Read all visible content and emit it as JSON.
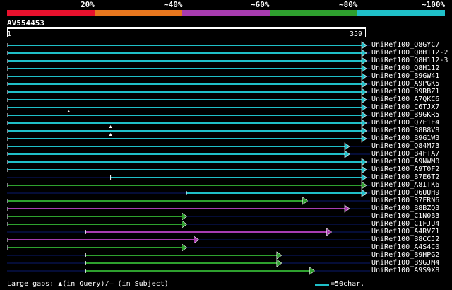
{
  "legend": {
    "labels": [
      "20%",
      "~40%",
      "~60%",
      "~80%",
      "~100%"
    ],
    "colors": [
      "#e8112d",
      "#e8771e",
      "#a83cb0",
      "#2ea02e",
      "#1fbfc8"
    ]
  },
  "query": {
    "name": "AV554453",
    "start": "1",
    "end": "359"
  },
  "hits": [
    {
      "label": "UniRef100_Q8GYC7",
      "color": "cyan",
      "start": 1,
      "end": 359,
      "gap": null
    },
    {
      "label": "UniRef100_Q8H112-2",
      "color": "cyan",
      "start": 1,
      "end": 359,
      "gap": null
    },
    {
      "label": "UniRef100_Q8H112-3",
      "color": "cyan",
      "start": 1,
      "end": 359,
      "gap": null
    },
    {
      "label": "UniRef100_Q8H112",
      "color": "cyan",
      "start": 1,
      "end": 359,
      "gap": null
    },
    {
      "label": "UniRef100_B9GW41",
      "color": "cyan",
      "start": 1,
      "end": 359,
      "gap": null
    },
    {
      "label": "UniRef100_A9PGK5",
      "color": "cyan",
      "start": 1,
      "end": 359,
      "gap": null
    },
    {
      "label": "UniRef100_B9RBZ1",
      "color": "cyan",
      "start": 1,
      "end": 359,
      "gap": null
    },
    {
      "label": "UniRef100_A7QKC6",
      "color": "cyan",
      "start": 1,
      "end": 359,
      "gap": null
    },
    {
      "label": "UniRef100_C6TJX7",
      "color": "cyan",
      "start": 1,
      "end": 359,
      "gap": null
    },
    {
      "label": "UniRef100_B9GKR5",
      "color": "cyan",
      "start": 1,
      "end": 359,
      "gap": 62
    },
    {
      "label": "UniRef100_Q7F1E4",
      "color": "cyan",
      "start": 1,
      "end": 359,
      "gap": null
    },
    {
      "label": "UniRef100_B8B8V8",
      "color": "cyan",
      "start": 1,
      "end": 359,
      "gap": 104
    },
    {
      "label": "UniRef100_B9G1W3",
      "color": "cyan",
      "start": 1,
      "end": 359,
      "gap": 104
    },
    {
      "label": "UniRef100_Q84M73",
      "color": "cyan",
      "start": 1,
      "end": 342,
      "gap": null
    },
    {
      "label": "UniRef100_B4FTA7",
      "color": "cyan",
      "start": 1,
      "end": 342,
      "gap": null
    },
    {
      "label": "UniRef100_A9NWM0",
      "color": "cyan",
      "start": 1,
      "end": 359,
      "gap": null
    },
    {
      "label": "UniRef100_A9T0F2",
      "color": "cyan",
      "start": 1,
      "end": 359,
      "gap": null
    },
    {
      "label": "UniRef100_B7E6T2",
      "color": "cyan",
      "start": 104,
      "end": 359,
      "gap": null
    },
    {
      "label": "UniRef100_A8ITK6",
      "color": "green",
      "start": 1,
      "end": 359,
      "gap": null
    },
    {
      "label": "UniRef100_Q6UUH9",
      "color": "cyan",
      "start": 180,
      "end": 359,
      "gap": null
    },
    {
      "label": "UniRef100_B7FRN6",
      "color": "green",
      "start": 1,
      "end": 300,
      "gap": null
    },
    {
      "label": "UniRef100_B8BZQ3",
      "color": "purple",
      "start": 1,
      "end": 342,
      "gap": null
    },
    {
      "label": "UniRef100_C1N0B3",
      "color": "green",
      "start": 1,
      "end": 179,
      "gap": null
    },
    {
      "label": "UniRef100_C1FJU4",
      "color": "green",
      "start": 1,
      "end": 179,
      "gap": null
    },
    {
      "label": "UniRef100_A4RVZ1",
      "color": "purple",
      "start": 79,
      "end": 324,
      "gap": null
    },
    {
      "label": "UniRef100_B8CCJ2",
      "color": "purple",
      "start": 1,
      "end": 191,
      "gap": null
    },
    {
      "label": "UniRef100_A4S4C0",
      "color": "green",
      "start": 1,
      "end": 179,
      "gap": null
    },
    {
      "label": "UniRef100_B9HPG2",
      "color": "green",
      "start": 79,
      "end": 274,
      "gap": null
    },
    {
      "label": "UniRef100_B9GJM4",
      "color": "green",
      "start": 79,
      "end": 274,
      "gap": null
    },
    {
      "label": "UniRef100_A9S9X8",
      "color": "green",
      "start": 79,
      "end": 307,
      "gap": null
    }
  ],
  "footer": {
    "note": "Large gaps: ▲(in Query)/– (in Subject)",
    "scale": "=50char."
  }
}
